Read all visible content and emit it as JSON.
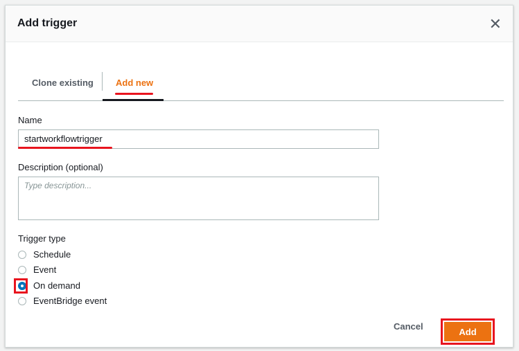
{
  "dialog": {
    "title": "Add trigger",
    "close_icon": "close-icon"
  },
  "tabs": [
    {
      "label": "Clone existing",
      "active": false
    },
    {
      "label": "Add new",
      "active": true
    }
  ],
  "form": {
    "name_label": "Name",
    "name_value": "startworkflowtrigger",
    "description_label": "Description (optional)",
    "description_placeholder": "Type description...",
    "trigger_type_label": "Trigger type",
    "trigger_options": [
      {
        "label": "Schedule",
        "selected": false
      },
      {
        "label": "Event",
        "selected": false
      },
      {
        "label": "On demand",
        "selected": true
      },
      {
        "label": "EventBridge event",
        "selected": false
      }
    ]
  },
  "footer": {
    "cancel_label": "Cancel",
    "add_label": "Add"
  },
  "colors": {
    "accent": "#ec7211",
    "highlight": "#e8141e",
    "radio_selected": "#0073bb"
  }
}
